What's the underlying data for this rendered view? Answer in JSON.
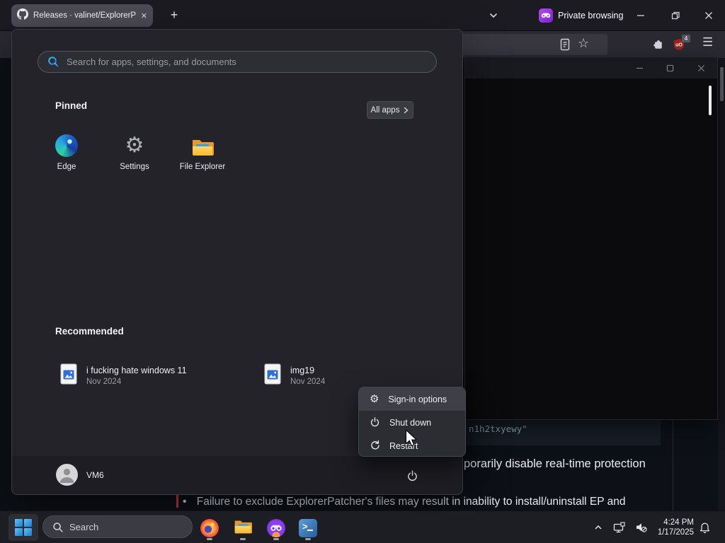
{
  "browser": {
    "tab_title": "Releases · valinet/ExplorerPatch",
    "new_tab_glyph": "+",
    "private_label": "Private browsing",
    "ublock_badge": "4",
    "page": {
      "code_fragment": "n1h2txyewy\"",
      "line_fragment": "porarily disable real-time protection",
      "bullet_prefix": "•",
      "bullet_text": "Failure to exclude ExplorerPatcher's files may result in inability to install/uninstall EP and"
    }
  },
  "start_menu": {
    "search_placeholder": "Search for apps, settings, and documents",
    "pinned": {
      "header": "Pinned",
      "all_apps_label": "All apps",
      "apps": [
        {
          "label": "Edge"
        },
        {
          "label": "Settings"
        },
        {
          "label": "File Explorer"
        }
      ]
    },
    "recommended": {
      "header": "Recommended",
      "items": [
        {
          "title": "i fucking hate windows 11",
          "date": "Nov 2024"
        },
        {
          "title": "img19",
          "date": "Nov 2024"
        }
      ]
    },
    "user": {
      "name": "VM6"
    }
  },
  "power_menu": {
    "items": [
      {
        "label": "Sign-in options"
      },
      {
        "label": "Shut down"
      },
      {
        "label": "Restart"
      }
    ]
  },
  "taskbar": {
    "search_placeholder": "Search"
  },
  "tray": {
    "time": "4:24 PM",
    "date": "1/17/2025"
  },
  "colors": {
    "accent_blue": "#2f86e0",
    "private_purple": "#7a1fd0",
    "ublock_red": "#9c241a"
  }
}
